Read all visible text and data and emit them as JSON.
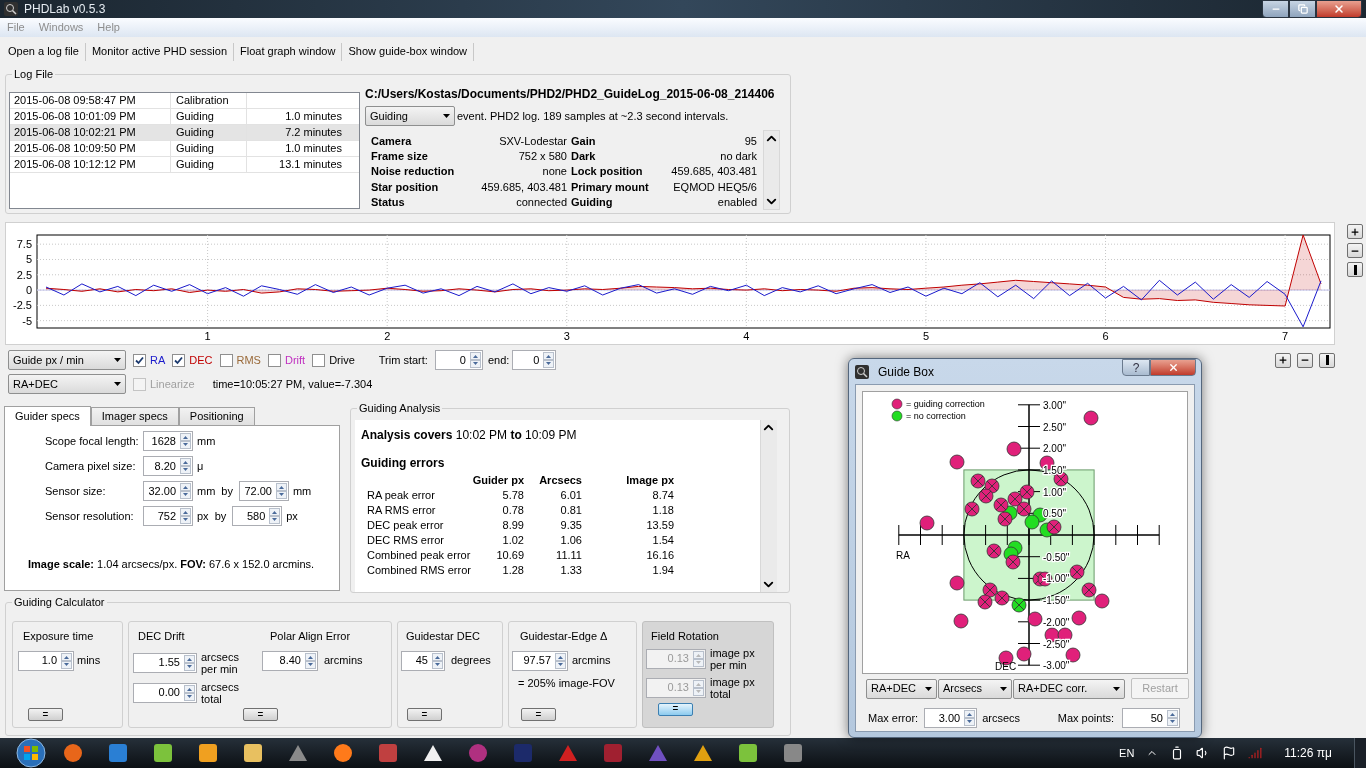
{
  "window": {
    "title": "PHDLab v0.5.3"
  },
  "menu": [
    "File",
    "Windows",
    "Help"
  ],
  "toolbar": [
    "Open a log file",
    "Monitor active PHD session",
    "Float graph window",
    "Show guide-box window"
  ],
  "log_file": {
    "title": "Log File",
    "sessions": [
      {
        "time": "2015-06-08 09:58:47 PM",
        "event": "Calibration",
        "selected": false
      },
      {
        "time": "2015-06-08 10:01:09 PM",
        "event": "Guiding",
        "duration": "1.0 minutes",
        "selected": false
      },
      {
        "time": "2015-06-08 10:02:21 PM",
        "event": "Guiding",
        "duration": "7.2 minutes",
        "selected": true
      },
      {
        "time": "2015-06-08 10:09:50 PM",
        "event": "Guiding",
        "duration": "1.0 minutes",
        "selected": false
      },
      {
        "time": "2015-06-08 10:12:12 PM",
        "event": "Guiding",
        "duration": "13.1 minutes",
        "selected": false
      }
    ],
    "path": "C:/Users/Kostas/Documents/PHD2/PHD2_GuideLog_2015-06-08_214406",
    "event_filter": "Guiding",
    "summary": "event. PHD2 log. 189 samples at ~2.3 second intervals.",
    "info": [
      {
        "label": "Camera",
        "value": "SXV-Lodestar"
      },
      {
        "label": "Gain",
        "value": "95"
      },
      {
        "label": "Frame size",
        "value": "752 x 580"
      },
      {
        "label": "Dark",
        "value": "no dark"
      },
      {
        "label": "Noise reduction",
        "value": "none"
      },
      {
        "label": "Lock position",
        "value": "459.685, 403.481"
      },
      {
        "label": "Star position",
        "value": "459.685, 403.481"
      },
      {
        "label": "Primary mount",
        "value": "EQMOD HEQ5/6"
      },
      {
        "label": "Status",
        "value": "connected"
      },
      {
        "label": "Guiding",
        "value": "enabled"
      }
    ]
  },
  "graph": {
    "chart_data": {
      "type": "line",
      "grid": true,
      "xlim": [
        0.05,
        7.25
      ],
      "ylim": [
        -6.2,
        9
      ],
      "xticks": [
        1,
        2,
        3,
        4,
        5,
        6,
        7
      ],
      "yticks": [
        7.5,
        5,
        2.5,
        0,
        -2.5,
        -5
      ],
      "x": [
        0.1,
        0.2,
        0.3,
        0.4,
        0.5,
        0.6,
        0.7,
        0.8,
        0.9,
        1.0,
        1.1,
        1.2,
        1.3,
        1.4,
        1.5,
        1.6,
        1.7,
        1.8,
        1.9,
        2.0,
        2.1,
        2.2,
        2.3,
        2.4,
        2.5,
        2.6,
        2.7,
        2.8,
        2.9,
        3.0,
        3.1,
        3.2,
        3.3,
        3.4,
        3.5,
        3.6,
        3.7,
        3.8,
        3.9,
        4.0,
        4.1,
        4.2,
        4.3,
        4.4,
        4.5,
        4.6,
        4.7,
        4.8,
        4.9,
        5.0,
        5.1,
        5.2,
        5.3,
        5.4,
        5.5,
        5.6,
        5.7,
        5.8,
        5.9,
        6.0,
        6.1,
        6.2,
        6.3,
        6.4,
        6.5,
        6.6,
        6.7,
        6.8,
        6.9,
        7.0,
        7.1,
        7.2
      ],
      "series": [
        {
          "name": "RA",
          "color": "#1a1acc",
          "values": [
            0.5,
            -0.8,
            1.0,
            -0.3,
            0.6,
            -0.9,
            0.8,
            -0.2,
            0.9,
            -0.6,
            0.4,
            -1.0,
            0.7,
            0.1,
            -0.7,
            0.9,
            -0.4,
            0.5,
            -0.8,
            0.3,
            0.8,
            -0.5,
            0.2,
            -0.9,
            0.6,
            -0.3,
            1.0,
            -0.6,
            0.4,
            -0.2,
            0.7,
            -0.8,
            0.3,
            0.9,
            -0.5,
            0.2,
            -0.7,
            0.6,
            -0.1,
            0.8,
            -0.9,
            0.4,
            -0.3,
            0.7,
            -0.6,
            0.2,
            0.9,
            -0.4,
            0.5,
            -1.0,
            0.3,
            -0.6,
            1.2,
            -1.1,
            0.8,
            -1.4,
            1.5,
            -0.9,
            1.1,
            -1.3,
            0.6,
            -1.6,
            1.6,
            -0.8,
            1.3,
            -1.5,
            0.9,
            -1.2,
            1.4,
            -0.7,
            -6.0,
            1.5
          ]
        },
        {
          "name": "DEC",
          "color": "#c00000",
          "values": [
            0.3,
            0.1,
            -0.2,
            0.2,
            -0.3,
            0.1,
            -0.1,
            0.2,
            -0.4,
            0.0,
            -0.2,
            0.1,
            -0.5,
            -0.3,
            0.2,
            0.1,
            -0.2,
            -0.1,
            0.0,
            0.3,
            0.1,
            -0.2,
            -0.1,
            0.2,
            0.0,
            -0.3,
            0.1,
            0.2,
            -0.1,
            0.0,
            0.2,
            0.1,
            0.3,
            0.6,
            0.5,
            0.4,
            0.2,
            0.3,
            0.1,
            0.0,
            0.2,
            -0.1,
            0.1,
            0.0,
            -0.2,
            0.3,
            0.4,
            0.2,
            0.1,
            0.3,
            0.5,
            0.8,
            1.0,
            1.3,
            1.6,
            1.4,
            1.2,
            1.0,
            0.8,
            0.5,
            -1.2,
            -1.5,
            -1.4,
            -1.7,
            -1.6,
            -2.0,
            -2.2,
            -2.4,
            -2.5,
            -2.6,
            9.0,
            1.0
          ]
        }
      ]
    }
  },
  "graph_controls": {
    "units": "Guide px / min",
    "axes": "RA+DEC",
    "series": [
      {
        "kind": "plotted",
        "checked": true
      },
      {
        "kind": "plotted",
        "checked": true
      },
      {
        "kind": "overlay",
        "label": "RMS",
        "checked": false,
        "color": "#9a6a3a"
      },
      {
        "kind": "overlay",
        "label": "Drift",
        "checked": false,
        "color": "#c030c0"
      },
      {
        "kind": "overlay",
        "label": "Drive",
        "checked": false
      }
    ],
    "linearize": {
      "label": "Linearize",
      "checked": false,
      "disabled": true
    },
    "trim_start_label": "Trim start:",
    "trim_start": "0",
    "trim_end_label": "end:",
    "trim_end": "0",
    "readout": "time=10:05:27 PM, value=-7.304"
  },
  "tabs": [
    {
      "label": "Guider specs",
      "selected": true
    },
    {
      "label": "Imager specs",
      "selected": false
    },
    {
      "label": "Positioning",
      "selected": false
    }
  ],
  "guider_specs": {
    "fields": [
      {
        "label": "Scope focal length:",
        "value": "1628",
        "unit": "mm"
      },
      {
        "label": "Camera pixel size:",
        "value": "8.20",
        "unit": "μ"
      },
      {
        "label": "Sensor size:",
        "value": "32.00",
        "unit": "mm",
        "by": "by",
        "value2": "72.00",
        "unit2": "mm"
      },
      {
        "label": "Sensor resolution:",
        "value": "752",
        "unit": "px",
        "by": "by",
        "value2": "580",
        "unit2": "px"
      }
    ],
    "image_scale": "**Image scale:** 1.04 arcsecs/px. **FOV:** 67.6 x 152.0 arcmins."
  },
  "analysis": {
    "title": "Guiding Analysis",
    "covers": "**Analysis covers** 10:02 PM **to** 10:09 PM",
    "heading": "Guiding errors",
    "columns": [
      "Guider px",
      "Arcsecs",
      "Image px"
    ],
    "rows": [
      {
        "label": "RA peak error",
        "values": [
          "5.78",
          "6.01",
          "8.74"
        ]
      },
      {
        "label": "RA RMS error",
        "values": [
          "0.78",
          "0.81",
          "1.18"
        ]
      },
      {
        "label": "DEC peak error",
        "values": [
          "8.99",
          "9.35",
          "13.59"
        ]
      },
      {
        "label": "DEC RMS error",
        "values": [
          "1.02",
          "1.06",
          "1.54"
        ]
      },
      {
        "label": "Combined peak error",
        "values": [
          "10.69",
          "11.11",
          "16.16"
        ]
      },
      {
        "label": "Combined RMS error",
        "values": [
          "1.28",
          "1.33",
          "1.94"
        ]
      }
    ]
  },
  "calculator": {
    "title": "Guiding Calculator",
    "exposure": {
      "title": "Exposure time",
      "value": "1.0",
      "unit": "mins",
      "button": {
        "label": "=",
        "focused": false
      }
    },
    "dec_drift": {
      "title": "DEC Drift",
      "rate": "1.55",
      "rate_unit": "arcsecs per min",
      "total": "0.00",
      "total_unit": "arcsecs total"
    },
    "polar_align": {
      "title": "Polar Align Error",
      "value": "8.40",
      "unit": "arcmins",
      "button": {
        "label": "=",
        "focused": false
      }
    },
    "guidestar_dec": {
      "title": "Guidestar DEC",
      "value": "45",
      "unit": "degrees",
      "button": {
        "label": "=",
        "focused": false
      }
    },
    "edge": {
      "title": "Guidestar-Edge Δ",
      "value": "97.57",
      "unit": "arcmins",
      "note": "= 205% image-FOV",
      "button": {
        "label": "=",
        "focused": false
      }
    },
    "field_rotation": {
      "title": "Field Rotation",
      "rate": "0.13",
      "rate_unit": "image px per min",
      "total": "0.13",
      "total_unit": "image px total",
      "disabled": true,
      "button": {
        "label": "=",
        "focused": true
      }
    }
  },
  "guide_box": {
    "title": "Guide Box",
    "help": "?",
    "legend": [
      {
        "label": "= guiding correction",
        "color": "#e0207a"
      },
      {
        "label": "= no correction",
        "color": "#22dd22"
      }
    ],
    "y_labels": [
      "3.00\"",
      "2.50\"",
      "2.00\"",
      "1.50\"",
      "1.00\"",
      "0.50\"",
      "-0.50\"",
      "-1.00\"",
      "-1.50\"",
      "-2.00\"",
      "-2.50\"",
      "-3.00\""
    ],
    "x_axis": "RA",
    "y_axis": "DEC",
    "selects": [
      "RA+DEC",
      "Arcsecs",
      "RA+DEC corr."
    ],
    "restart": {
      "label": "Restart",
      "disabled": true
    },
    "max_error_label": "Max error:",
    "max_error": "3.00",
    "max_error_unit": "arcsecs",
    "max_points_label": "Max points:",
    "max_points": "50"
  },
  "taskbar": {
    "language": "EN",
    "clock": "11:26 πμ"
  }
}
